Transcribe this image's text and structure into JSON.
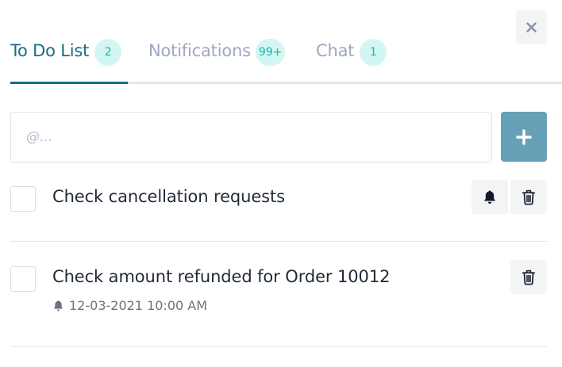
{
  "tabs": [
    {
      "label": "To Do List",
      "count": "2"
    },
    {
      "label": "Notifications",
      "count": "99+"
    },
    {
      "label": "Chat",
      "count": "1"
    }
  ],
  "close_icon": "close-icon",
  "input": {
    "placeholder": "@...",
    "value": ""
  },
  "add_icon": "plus-icon",
  "todos": [
    {
      "text": "Check cancellation requests",
      "checked": false,
      "reminder": ""
    },
    {
      "text": "Check amount refunded for Order 10012",
      "checked": false,
      "reminder": "12-03-2021 10:00 AM"
    }
  ],
  "colors": {
    "accent": "#1a6b85",
    "badge_bg": "#d2f6f1",
    "badge_text": "#19b6a8",
    "add_button": "#67a1b8",
    "inactive_tab": "#9ea7c0"
  }
}
